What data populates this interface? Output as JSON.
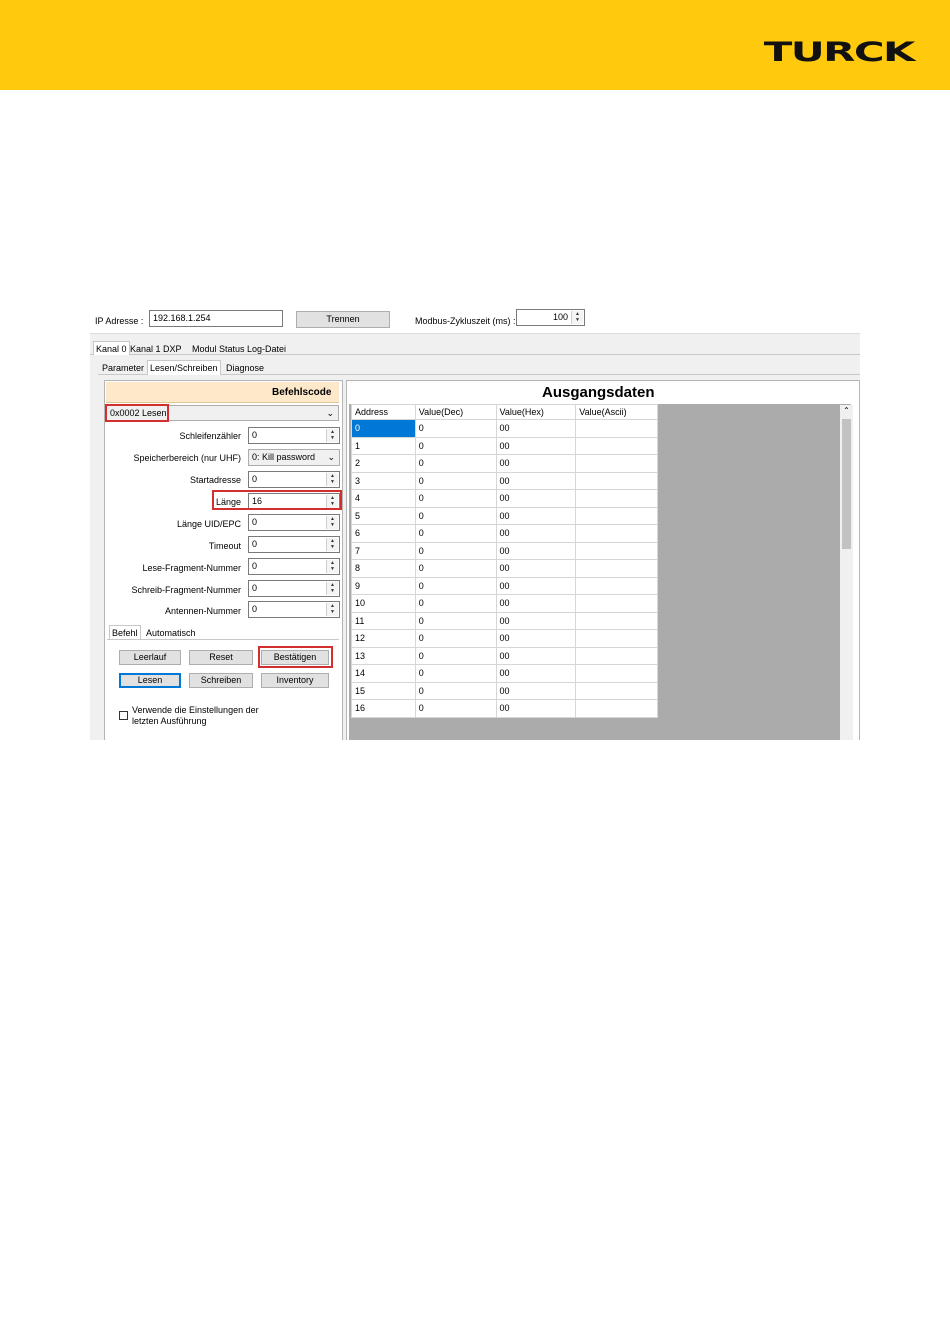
{
  "brand": {
    "logo_text": "TURCK",
    "header_color": "#ffc90e"
  },
  "connection": {
    "ip_label": "IP Adresse :",
    "ip_value": "192.168.1.254",
    "disconnect_label": "Trennen",
    "cycle_label": "Modbus-Zykluszeit (ms) :",
    "cycle_value": "100"
  },
  "main_tabs": [
    "Kanal 0",
    "Kanal 1",
    "DXP",
    "Modul Status",
    "Log-Datei"
  ],
  "sub_tabs": [
    "Parameter",
    "Lesen/Schreiben",
    "Diagnose"
  ],
  "command_panel": {
    "title": "Befehlscode",
    "command_value": "0x0002 Lesen",
    "fields": {
      "loop_counter": {
        "label": "Schleifenzähler",
        "value": "0"
      },
      "memory_area": {
        "label": "Speicherbereich (nur UHF)",
        "value": "0: Kill password"
      },
      "start_address": {
        "label": "Startadresse",
        "value": "0"
      },
      "length": {
        "label": "Länge",
        "value": "16"
      },
      "uid_length": {
        "label": "Länge UID/EPC",
        "value": "0"
      },
      "timeout": {
        "label": "Timeout",
        "value": "0"
      },
      "read_fragment": {
        "label": "Lese-Fragment-Nummer",
        "value": "0"
      },
      "write_fragment": {
        "label": "Schreib-Fragment-Nummer",
        "value": "0"
      },
      "antenna": {
        "label": "Antennen-Nummer",
        "value": "0"
      }
    },
    "mode_tabs": [
      "Befehl",
      "Automatisch"
    ],
    "buttons": {
      "idle": "Leerlauf",
      "reset": "Reset",
      "confirm": "Bestätigen",
      "read": "Lesen",
      "write": "Schreiben",
      "inventory": "Inventory"
    },
    "reuse_checkbox": {
      "line1": "Verwende die Einstellungen der",
      "line2": "letzten Ausführung",
      "checked": false
    }
  },
  "output_panel": {
    "title": "Ausgangsdaten",
    "columns": [
      "Address",
      "Value(Dec)",
      "Value(Hex)",
      "Value(Ascii)"
    ],
    "rows": [
      [
        "0",
        "0",
        "00",
        ""
      ],
      [
        "1",
        "0",
        "00",
        ""
      ],
      [
        "2",
        "0",
        "00",
        ""
      ],
      [
        "3",
        "0",
        "00",
        ""
      ],
      [
        "4",
        "0",
        "00",
        ""
      ],
      [
        "5",
        "0",
        "00",
        ""
      ],
      [
        "6",
        "0",
        "00",
        ""
      ],
      [
        "7",
        "0",
        "00",
        ""
      ],
      [
        "8",
        "0",
        "00",
        ""
      ],
      [
        "9",
        "0",
        "00",
        ""
      ],
      [
        "10",
        "0",
        "00",
        ""
      ],
      [
        "11",
        "0",
        "00",
        ""
      ],
      [
        "12",
        "0",
        "00",
        ""
      ],
      [
        "13",
        "0",
        "00",
        ""
      ],
      [
        "14",
        "0",
        "00",
        ""
      ],
      [
        "15",
        "0",
        "00",
        ""
      ],
      [
        "16",
        "0",
        "00",
        ""
      ]
    ]
  }
}
